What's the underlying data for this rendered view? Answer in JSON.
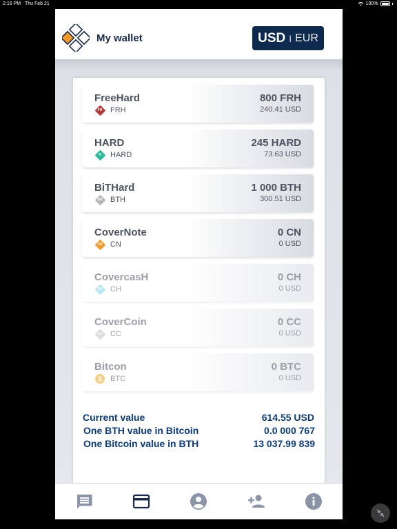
{
  "status_bar": {
    "time": "2:16 PM",
    "date": "Thu Feb 21",
    "battery": "100%"
  },
  "header": {
    "title": "My wallet",
    "currency_active": "USD",
    "currency_separator": "I",
    "currency_inactive": "EUR"
  },
  "wallets": [
    {
      "name": "FreeHard",
      "symbol": "FRH",
      "badge": "FH",
      "badge_color": "#b23a3a",
      "badge_shape": "diamond",
      "amount": "800 FRH",
      "usd": "240.41 USD",
      "dim": false
    },
    {
      "name": "HARD",
      "symbol": "HARD",
      "badge": "H",
      "badge_color": "#2fb89a",
      "badge_shape": "diamond",
      "amount": "245 HARD",
      "usd": "73.63 USD",
      "dim": false
    },
    {
      "name": "BiTHard",
      "symbol": "BTH",
      "badge": "BH",
      "badge_color": "#b5b5b5",
      "badge_shape": "diamond",
      "amount": "1 000 BTH",
      "usd": "300.51 USD",
      "dim": false
    },
    {
      "name": "CoverNote",
      "symbol": "CN",
      "badge": "CN",
      "badge_color": "#f29a2e",
      "badge_shape": "diamond",
      "amount": "0 CN",
      "usd": "0 USD",
      "dim": false
    },
    {
      "name": "CovercasH",
      "symbol": "CH",
      "badge": "CH",
      "badge_color": "#7fd0ee",
      "badge_shape": "diamond",
      "amount": "0 CH",
      "usd": "0 USD",
      "dim": true
    },
    {
      "name": "CoverCoin",
      "symbol": "CC",
      "badge": "CC",
      "badge_color": "#bfbfbf",
      "badge_shape": "diamond",
      "amount": "0 CC",
      "usd": "0 USD",
      "dim": true
    },
    {
      "name": "Bitcon",
      "symbol": "BTC",
      "badge": "₿",
      "badge_color": "#f4a51c",
      "badge_shape": "circle",
      "amount": "0 BTC",
      "usd": "0 USD",
      "dim": true
    }
  ],
  "summary": [
    {
      "label": "Current value",
      "value": "614.55 USD"
    },
    {
      "label": "One BTH value in Bitcoin",
      "value": "0.0 000 767"
    },
    {
      "label": "One Bitcoin value in BTH",
      "value": "13 037.99 839"
    }
  ],
  "nav": [
    {
      "icon": "chat-icon",
      "color": "#8a94a6"
    },
    {
      "icon": "card-icon",
      "color": "#1b2a48"
    },
    {
      "icon": "account-icon",
      "color": "#8a94a6"
    },
    {
      "icon": "add-user-icon",
      "color": "#8a94a6"
    },
    {
      "icon": "info-icon",
      "color": "#8a94a6"
    }
  ],
  "colors": {
    "accent": "#0f2a4f",
    "summary_text": "#0b3a7c",
    "logo_orange": "#f29a2e"
  }
}
